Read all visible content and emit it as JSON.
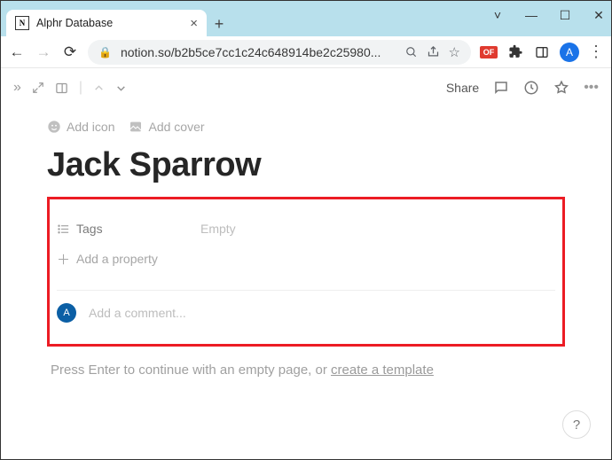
{
  "browser": {
    "tab_title": "Alphr Database",
    "url_display": "notion.so/b2b5ce7cc1c24c648914be2c25980...",
    "avatar_initial": "A",
    "ext_of_label": "OF"
  },
  "topbar": {
    "share_label": "Share"
  },
  "page": {
    "add_icon_label": "Add icon",
    "add_cover_label": "Add cover",
    "title": "Jack Sparrow",
    "properties": [
      {
        "name": "Tags",
        "value": "Empty"
      }
    ],
    "add_property_label": "Add a property",
    "comment_avatar_initial": "A",
    "comment_placeholder": "Add a comment...",
    "hint_prefix": "Press Enter to continue with an empty page, or ",
    "hint_link": "create a template"
  },
  "help": {
    "label": "?"
  }
}
